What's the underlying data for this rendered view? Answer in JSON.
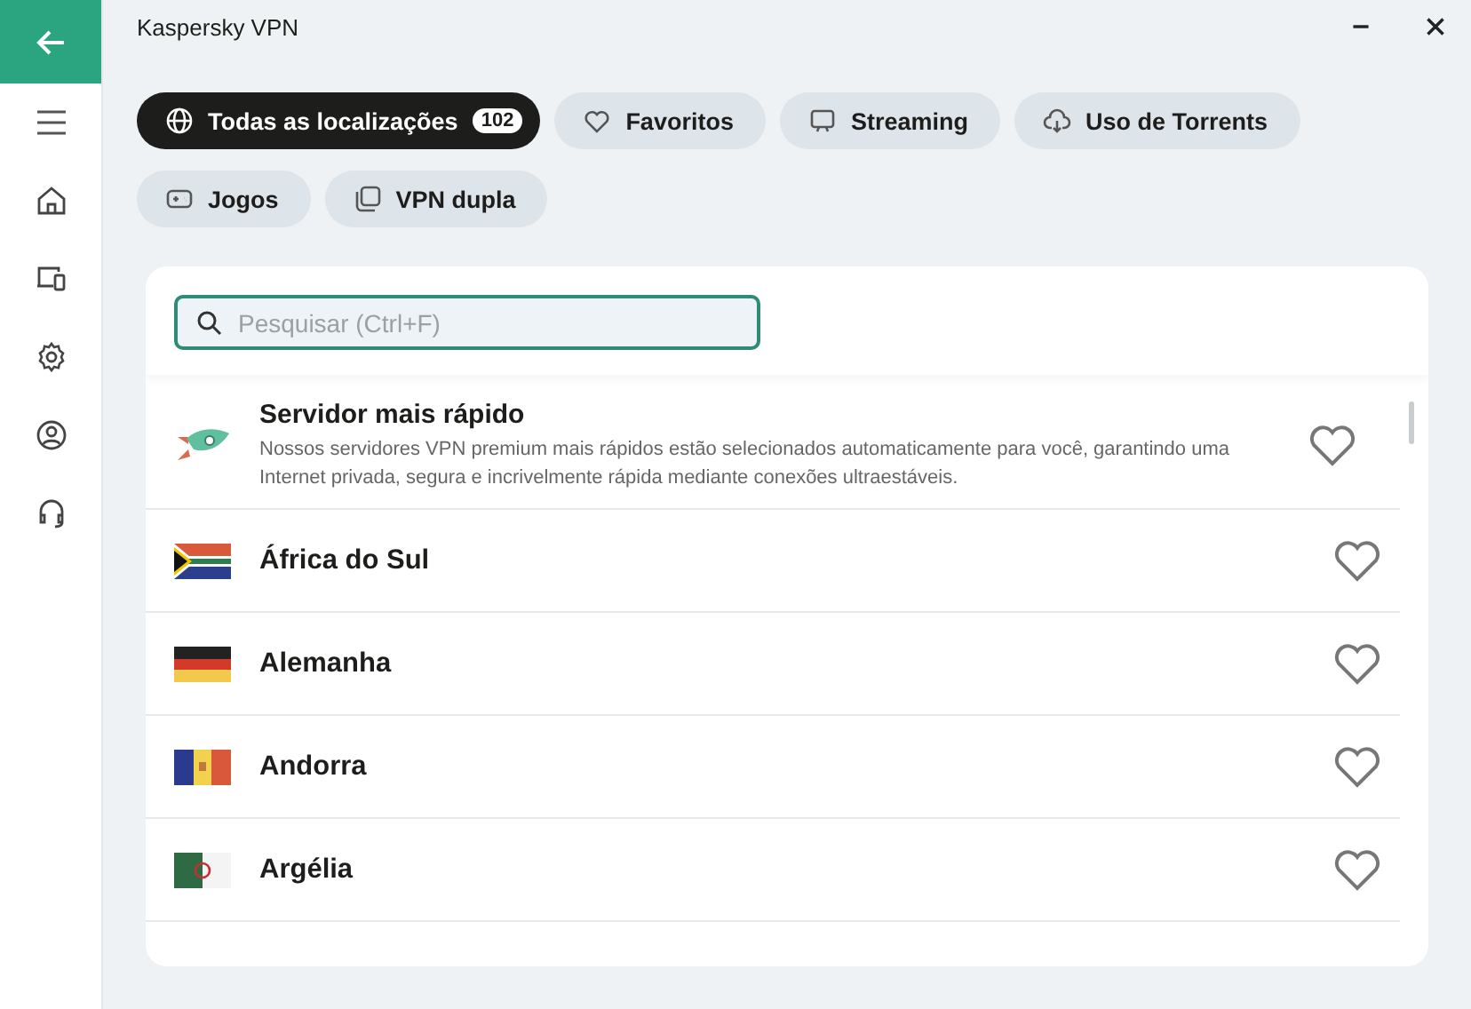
{
  "window": {
    "title": "Kaspersky VPN"
  },
  "sidebar": {
    "items": [
      {
        "kind": "menu",
        "selected": false
      },
      {
        "kind": "home",
        "selected": false
      },
      {
        "kind": "devices",
        "selected": false
      },
      {
        "kind": "settings",
        "selected": false
      },
      {
        "kind": "account",
        "selected": false
      },
      {
        "kind": "support",
        "selected": false
      }
    ]
  },
  "tabs": [
    {
      "kind": "globe",
      "label": "Todas as localizações",
      "count": "102",
      "selected": true
    },
    {
      "kind": "heart",
      "label": "Favoritos",
      "selected": false
    },
    {
      "kind": "screen",
      "label": "Streaming",
      "selected": false
    },
    {
      "kind": "download",
      "label": "Uso de Torrents",
      "selected": false
    },
    {
      "kind": "gamepad",
      "label": "Jogos",
      "selected": false
    },
    {
      "kind": "double",
      "label": "VPN dupla",
      "selected": false
    }
  ],
  "search": {
    "placeholder": "Pesquisar (Ctrl+F)"
  },
  "fastest": {
    "title": "Servidor mais rápido",
    "description": "Nossos servidores VPN premium mais rápidos estão selecionados automaticamente para você, garantindo uma Internet privada, segura e incrivelmente rápida mediante conexões ultraestáveis.",
    "favorite": false
  },
  "locations": [
    {
      "kind": "za",
      "name": "África do Sul",
      "favorite": false
    },
    {
      "kind": "de",
      "name": "Alemanha",
      "favorite": false
    },
    {
      "kind": "ad",
      "name": "Andorra",
      "favorite": false
    },
    {
      "kind": "dz",
      "name": "Argélia",
      "favorite": false
    }
  ]
}
